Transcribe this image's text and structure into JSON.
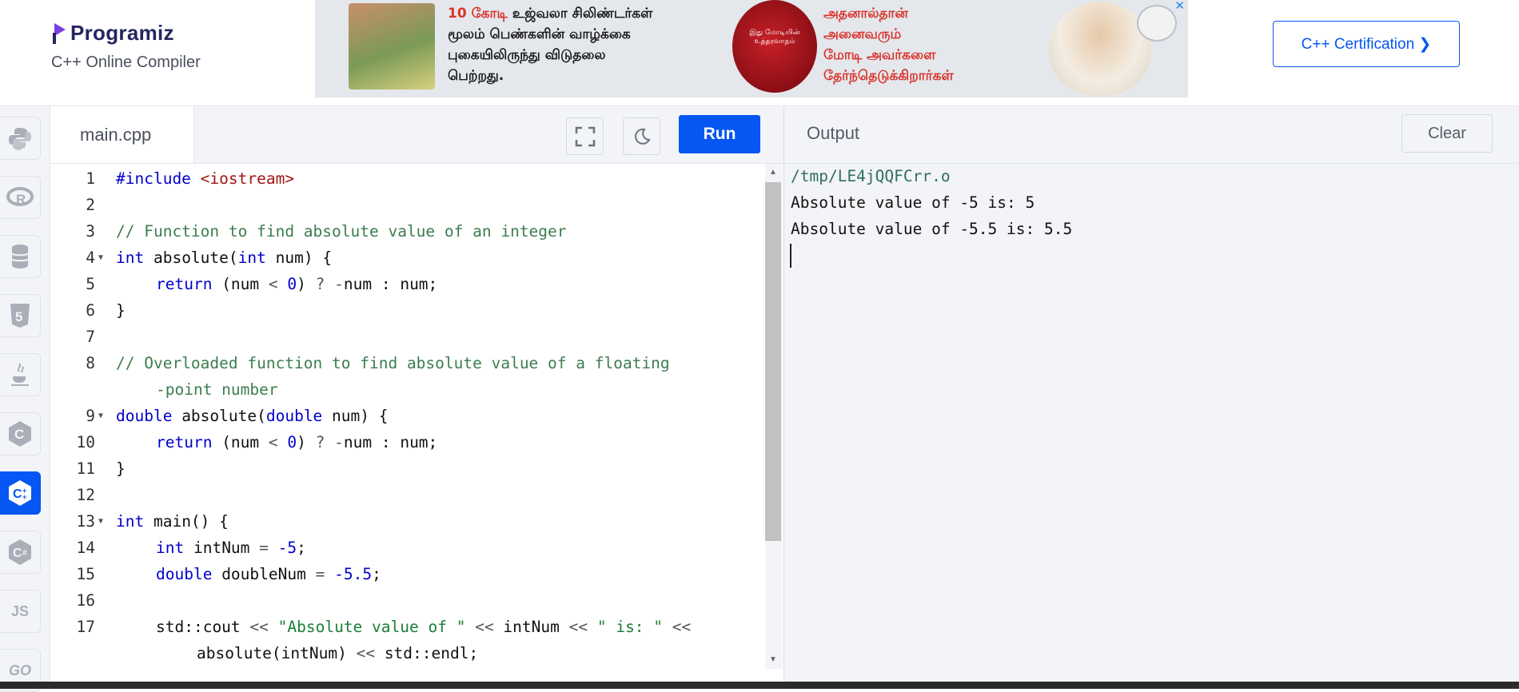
{
  "brand": {
    "name": "Programiz",
    "subtitle": "C++ Online Compiler"
  },
  "header": {
    "cert_button": "C++ Certification ❯"
  },
  "ad": {
    "text_highlight": "10 கோடி",
    "text1_rest": " உஜ்வலா சிலிண்டர்கள்",
    "text1_l2": "மூலம் பெண்களின் வாழ்க்கை",
    "text1_l3": "புகையிலிருந்து விடுதலை",
    "text1_l4": "பெற்றது.",
    "seal_text": "இது மோடியின் உத்தரவாதம்",
    "text2_l1": "அதனால்தான்",
    "text2_l2": "அனைவரும்",
    "text2_l3": "மோடி அவர்களை",
    "text2_l4": "தேர்ந்தெடுக்கிறார்கள்",
    "close": "✕"
  },
  "rail": {
    "js_label": "JS",
    "go_label": "GO"
  },
  "editor": {
    "tab": "main.cpp",
    "run_label": "Run"
  },
  "output": {
    "title": "Output",
    "clear_label": "Clear",
    "lines": [
      "/tmp/LE4jQQFCrr.o",
      "Absolute value of -5 is: 5",
      "Absolute value of -5.5 is: 5.5"
    ]
  },
  "code": {
    "line_numbers": [
      "1",
      "2",
      "3",
      "4",
      "5",
      "6",
      "7",
      "8",
      "9",
      "10",
      "11",
      "12",
      "13",
      "14",
      "15",
      "16",
      "17"
    ],
    "l1": {
      "a": "#include ",
      "b": "<iostream>"
    },
    "l3": "// Function to find absolute value of an integer",
    "l4": {
      "a": "int",
      "b": " absolute(",
      "c": "int",
      "d": " num) {"
    },
    "l5": {
      "a": "return",
      "b": " (num ",
      "c": "<",
      "d": " ",
      "e": "0",
      "f": ") ",
      "g": "?",
      "h": " ",
      "i": "-",
      "j": "num : num;"
    },
    "l6": "}",
    "l8a": "// Overloaded function to find absolute value of a floating",
    "l8b": "-point number",
    "l9": {
      "a": "double",
      "b": " absolute(",
      "c": "double",
      "d": " num) {"
    },
    "l10": {
      "a": "return",
      "b": " (num ",
      "c": "<",
      "d": " ",
      "e": "0",
      "f": ") ",
      "g": "?",
      "h": " ",
      "i": "-",
      "j": "num : num;"
    },
    "l11": "}",
    "l13": {
      "a": "int",
      "b": " main() {"
    },
    "l14": {
      "a": "int",
      "b": " intNum ",
      "c": "=",
      "d": " ",
      "e": "-5",
      "f": ";"
    },
    "l15": {
      "a": "double",
      "b": " doubleNum ",
      "c": "=",
      "d": " ",
      "e": "-5.5",
      "f": ";"
    },
    "l17a": {
      "a": "std::cout ",
      "b": "<<",
      "c": " ",
      "d": "\"Absolute value of \"",
      "e": " ",
      "f": "<<",
      "g": " intNum ",
      "h": "<<",
      "i": " ",
      "j": "\" is: \"",
      "k": " ",
      "l": "<<"
    },
    "l17b": {
      "a": "absolute(intNum) ",
      "b": "<<",
      "c": " std::endl;"
    }
  }
}
